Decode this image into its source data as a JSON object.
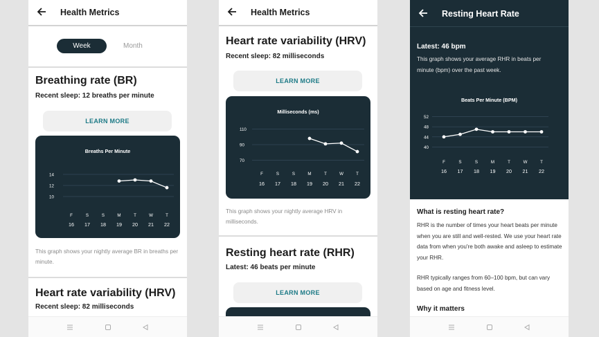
{
  "panel1": {
    "title": "Health Metrics",
    "toggle": {
      "week": "Week",
      "month": "Month"
    },
    "br_title": "Breathing rate (BR)",
    "br_sub": "Recent sleep: 12 breaths per minute",
    "learn_more": "LEARN MORE",
    "br_caption": "This graph shows your nightly average BR in breaths per minute.",
    "hrv_title": "Heart rate variability (HRV)",
    "hrv_sub": "Recent sleep: 82 milliseconds"
  },
  "panel2": {
    "title": "Health Metrics",
    "hrv_title": "Heart rate variability (HRV)",
    "hrv_sub": "Recent sleep: 82 milliseconds",
    "learn_more": "LEARN MORE",
    "hrv_caption": "This graph shows your nightly average HRV in milliseconds.",
    "rhr_title": "Resting heart rate (RHR)",
    "rhr_sub": "Latest: 46 beats per minute",
    "learn_more2": "LEARN MORE"
  },
  "panel3": {
    "title": "Resting Heart Rate",
    "latest": "Latest: 46 bpm",
    "desc": "This graph shows your average RHR in beats per minute (bpm) over the past week.",
    "what_h": "What is resting heart rate?",
    "what_p1": "RHR is the number of times your heart beats per minute when you are still and well-rested. We use your heart rate data from when you're both awake and asleep to estimate your RHR.",
    "what_p2": "RHR typically ranges from 60–100 bpm, but can vary based on age and fitness level.",
    "why_h": "Why it matters"
  },
  "colors": {
    "dark": "#1b2d36",
    "accent": "#1d7a86"
  },
  "chart_data": [
    {
      "type": "line",
      "title": "Breaths Per Minute",
      "categories": [
        "F 16",
        "S 17",
        "S 18",
        "M 19",
        "T 20",
        "W 21",
        "T 22"
      ],
      "days": [
        "F",
        "S",
        "S",
        "M",
        "T",
        "W",
        "T"
      ],
      "dates": [
        "16",
        "17",
        "18",
        "19",
        "20",
        "21",
        "22"
      ],
      "values": [
        null,
        null,
        null,
        12.8,
        13.0,
        12.8,
        11.6
      ],
      "yticks": [
        10,
        12,
        14
      ],
      "ylim": [
        9,
        15
      ],
      "grid": true
    },
    {
      "type": "line",
      "title": "Milliseconds (ms)",
      "categories": [
        "F 16",
        "S 17",
        "S 18",
        "M 19",
        "T 20",
        "W 21",
        "T 22"
      ],
      "days": [
        "F",
        "S",
        "S",
        "M",
        "T",
        "W",
        "T"
      ],
      "dates": [
        "16",
        "17",
        "18",
        "19",
        "20",
        "21",
        "22"
      ],
      "values": [
        null,
        null,
        null,
        98,
        91,
        92,
        81
      ],
      "yticks": [
        70,
        90,
        110
      ],
      "ylim": [
        65,
        115
      ],
      "grid": true
    },
    {
      "type": "line",
      "title": "Beats Per Minute (BPM)",
      "categories": [
        "F 16",
        "S 17",
        "S 18",
        "M 19",
        "T 20",
        "W 21",
        "T 22"
      ],
      "days": [
        "F",
        "S",
        "S",
        "M",
        "T",
        "W",
        "T"
      ],
      "dates": [
        "16",
        "17",
        "18",
        "19",
        "20",
        "21",
        "22"
      ],
      "values": [
        44,
        45,
        47,
        46,
        46,
        46,
        46
      ],
      "yticks": [
        40,
        44,
        48,
        52
      ],
      "ylim": [
        39,
        53
      ],
      "grid": true
    }
  ]
}
